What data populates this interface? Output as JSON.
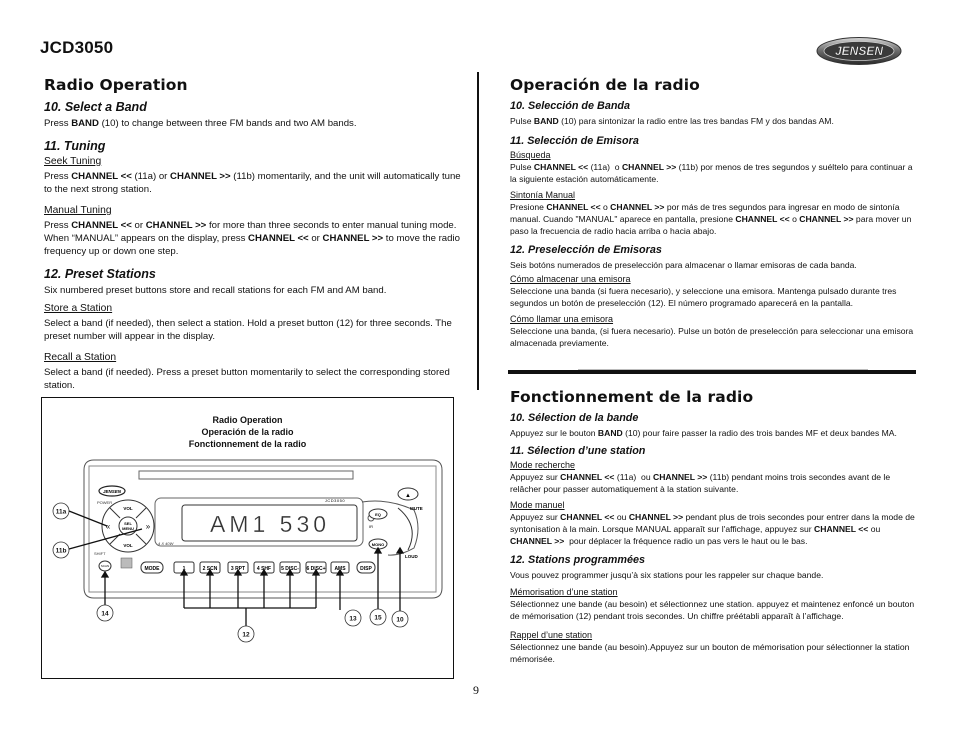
{
  "header": {
    "model": "JCD3050",
    "brand_logo": "JENSEN"
  },
  "english": {
    "title": "Radio Operation",
    "band": {
      "heading": "10. Select a Band",
      "text_pre": "Press ",
      "text_bold": "BAND",
      "text_post": " (10) to change between three FM bands and two AM bands."
    },
    "tuning": {
      "heading": "11. Tuning",
      "seek_sub": "Seek Tuning",
      "seek_text": "Press <b>CHANNEL &lt;&lt;</b> (11a) or <b>CHANNEL &gt;&gt;</b> (11b) momentarily, and the unit will automatically tune to the next strong station.",
      "manual_sub": "Manual Tuning",
      "manual_text": "Press <b>CHANNEL &lt;&lt;</b> or <b>CHANNEL &gt;&gt;</b> for more than three seconds to enter manual tuning mode. When “MANUAL” appears on the display, press <b>CHANNEL &lt;&lt;</b> or <b>CHANNEL &gt;&gt;</b> to move the radio frequency up or down one step."
    },
    "preset": {
      "heading": "12. Preset Stations",
      "intro": "Six numbered preset buttons store and recall stations for each FM and AM band.",
      "store_sub": "Store a Station",
      "store_text": "Select a band (if needed), then select a station. Hold a preset button (12) for three seconds. The preset number will appear in the display.",
      "recall_sub": "Recall a Station",
      "recall_text": "Select a band (if needed). Press a preset button momentarily to select the corresponding stored station."
    }
  },
  "spanish": {
    "title": "Operación de la radio",
    "band": {
      "heading": "10. Selección de Banda",
      "text": "Pulse <b>BAND</b> (10) para sintonizar la radio entre las tres bandas FM y dos bandas AM."
    },
    "tuning": {
      "heading": "11. Selección de Emisora",
      "seek_sub": "Búsqueda",
      "seek_text": "Pulse <b>CHANNEL &lt;&lt;</b> (11a)&nbsp; o <b>CHANNEL &gt;&gt;</b> (11b) por menos de tres segundos y suéltelo para continuar a la siguiente estación automáticamente.",
      "manual_sub": "Sintonía Manual",
      "manual_text": "Presione <b>CHANNEL &lt;&lt;</b> o <b>CHANNEL &gt;&gt;</b> por más de tres segundos para ingresar en modo de sintonía manual. Cuando \"MANUAL\" aparece en pantalla, presione <b>CHANNEL &lt;&lt;</b> o <b>CHANNEL &gt;&gt;</b> para mover un paso la frecuencia de radio hacia arriba o hacia abajo."
    },
    "preset": {
      "heading": "12. Preselección de Emisoras",
      "intro": "Seis botóns numerados de preselección para almacenar o llamar emisoras de cada banda.",
      "store_sub": "Cómo almacenar una emisora",
      "store_text": "Seleccione una banda (si fuera necesario), y seleccione una emisora. Mantenga pulsado durante tres segundos un botón de preselección (12). El número programado aparecerá en la pantalla.",
      "recall_sub": "Cómo llamar una emisora",
      "recall_text": "Seleccione una banda, (si fuera necesario). Pulse un botón de preselección para seleccionar una emisora almacenada previamente."
    }
  },
  "french": {
    "title": "Fonctionnement de la radio",
    "band": {
      "heading": "10. Sélection de la bande",
      "text": "Appuyez sur le bouton <b>BAND</b> (10) pour faire passer la radio des trois bandes MF et deux bandes MA."
    },
    "tuning": {
      "heading": "11. Sélection d’une station",
      "seek_sub": "Mode recherche",
      "seek_text": "Appuyez sur <b>CHANNEL &lt;&lt;</b> (11a)&nbsp; ou <b>CHANNEL &gt;&gt;</b> (11b) pendant moins trois secondes avant de le relâcher pour passer automatiquement à la station suivante.",
      "manual_sub": "Mode manuel",
      "manual_text": "Appuyez sur <b>CHANNEL &lt;&lt;</b> ou <b>CHANNEL &gt;&gt;</b> pendant plus de trois secondes pour entrer dans la mode de syntonisation à la main. Lorsque MANUAL apparaît sur l'affichage, appuyez sur <b>CHANNEL &lt;&lt;</b> ou <b>CHANNEL &gt;&gt;</b>&nbsp; pour déplacer la fréquence radio un pas vers le haut ou le bas."
    },
    "preset": {
      "heading": "12. Stations programmées",
      "intro": "Vous pouvez programmer jusqu’à six stations pour les rappeler sur chaque bande.",
      "store_sub": "Mémorisation d’une station",
      "store_text": "Sélectionnez une bande (au besoin) et sélectionnez une station. appuyez et maintenez enfoncé un bouton de mémorisation (12) pendant trois secondes. Un chiffre préétabli apparaît à l’affichage.",
      "recall_sub": "Rappel d’une station",
      "recall_text": "Sélectionnez une bande (au besoin).Appuyez sur un bouton de mémorisation pour sélectionner la station mémorisée."
    }
  },
  "figure": {
    "caption": [
      "Radio Operation",
      "Operación de la radio",
      "Fonctionnement de la radio"
    ],
    "display": "AM1 530",
    "model_label": "JCD3050",
    "power_label": "POWER",
    "shift_label": "SHIFT",
    "watt_label": "4 X 40W",
    "vol_up": "VOL",
    "vol_down": "VOL",
    "sel_menu": [
      "SEL",
      "MENU"
    ],
    "mute_label": "MUTE",
    "loud_label": "LOUD",
    "ir_label": "IR",
    "eq_label": "EQ",
    "mono_label": "MONO",
    "scan_label": "SCAN",
    "buttons": [
      "MODE",
      "1",
      "2 SCN",
      "3 RPT",
      "4 SHF",
      "5 DISC-",
      "6 DISC+",
      "AMS",
      "DISP"
    ],
    "callouts": [
      "11a",
      "11b",
      "14",
      "12",
      "13",
      "15",
      "10"
    ]
  },
  "page_number": "9"
}
